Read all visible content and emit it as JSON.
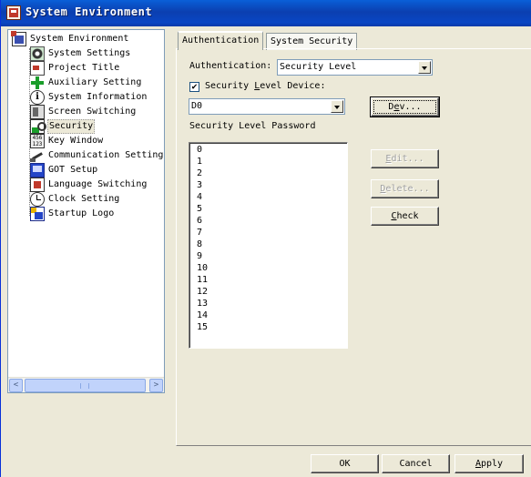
{
  "window": {
    "title": "System Environment"
  },
  "tree": {
    "root": "System Environment",
    "items": [
      {
        "label": "System Settings",
        "icon": "gear-icon"
      },
      {
        "label": "Project Title",
        "icon": "project-title-icon"
      },
      {
        "label": "Auxiliary Setting",
        "icon": "plus-icon"
      },
      {
        "label": "System Information",
        "icon": "info-icon"
      },
      {
        "label": "Screen Switching",
        "icon": "screen-icon"
      },
      {
        "label": "Security",
        "icon": "security-icon",
        "selected": true
      },
      {
        "label": "Key Window",
        "icon": "keyboard-icon"
      },
      {
        "label": "Communication Setting",
        "icon": "cable-icon"
      },
      {
        "label": "GOT Setup",
        "icon": "monitor-icon"
      },
      {
        "label": "Language Switching",
        "icon": "language-icon"
      },
      {
        "label": "Clock Setting",
        "icon": "clock-icon"
      },
      {
        "label": "Startup Logo",
        "icon": "logo-icon"
      }
    ],
    "key_window_icon_text": "456\n123"
  },
  "tabs": [
    {
      "label": "Authentication",
      "active": true
    },
    {
      "label": "System Security",
      "active": false
    }
  ],
  "auth": {
    "label": "Authentication:",
    "value": "Security Level",
    "device_checkbox_label_pre": "Security ",
    "device_checkbox_label_ul": "L",
    "device_checkbox_label_post": "evel Device:",
    "device_checked": true,
    "check_mark": "✔",
    "device_value": "D0",
    "dev_button_pre": "D",
    "dev_button_ul": "e",
    "dev_button_post": "v...",
    "password_label": "Security Level Password",
    "levels": [
      "0",
      "1",
      "2",
      "3",
      "4",
      "5",
      "6",
      "7",
      "8",
      "9",
      "10",
      "11",
      "12",
      "13",
      "14",
      "15"
    ],
    "edit_button_pre": "",
    "edit_button_ul": "E",
    "edit_button_post": "dit...",
    "delete_button_ul": "D",
    "delete_button_post": "elete...",
    "check_button_ul": "C",
    "check_button_post": "heck"
  },
  "footer": {
    "ok": "OK",
    "cancel": "Cancel",
    "apply_ul": "A",
    "apply_post": "pply"
  },
  "scrollbar": {
    "left_arrow": "<",
    "right_arrow": ">"
  }
}
